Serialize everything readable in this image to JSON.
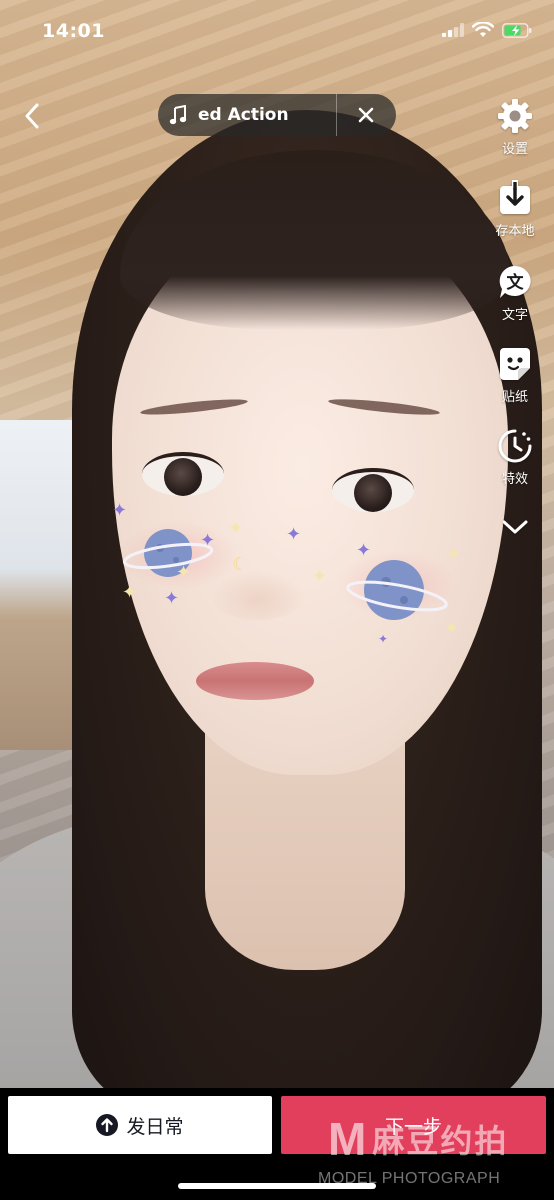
{
  "status_bar": {
    "time": "14:01"
  },
  "music": {
    "title": "ed Action"
  },
  "tools": [
    {
      "label": "设置",
      "icon": "gear-icon"
    },
    {
      "label": "存本地",
      "icon": "download-icon"
    },
    {
      "label": "文字",
      "icon": "text-icon"
    },
    {
      "label": "贴纸",
      "icon": "sticker-icon"
    },
    {
      "label": "特效",
      "icon": "effects-timer-icon"
    }
  ],
  "bottom": {
    "daily_label": "发日常",
    "next_label": "下一步"
  },
  "watermark": {
    "mark": "M",
    "cn": "麻豆约拍",
    "en": "MODEL PHOTOGRAPH"
  },
  "colors": {
    "accent": "#e23f5c",
    "dark_pill": "#282828",
    "sticker_planet": "#7f93c8"
  }
}
